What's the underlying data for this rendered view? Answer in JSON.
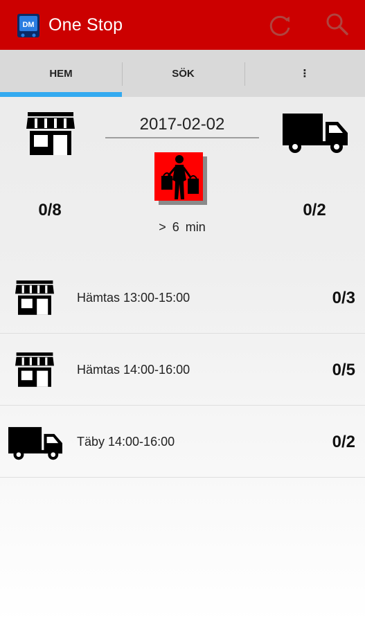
{
  "app": {
    "title": "One Stop",
    "logo_text": "DM",
    "accent_color": "#cc0000"
  },
  "toolbar": {
    "refresh_icon": "refresh-icon",
    "search_icon": "search-icon"
  },
  "tabs": [
    {
      "label": "HEM",
      "selected": true
    },
    {
      "label": "SÖK",
      "selected": false
    },
    {
      "label": "⋮",
      "selected": false
    }
  ],
  "summary": {
    "date": "2017-02-02",
    "store_count": "0/8",
    "delivery_count": "0/2",
    "wait_time": "> 6 min",
    "store_icon": "store-icon",
    "truck_icon": "truck-icon",
    "shopper_icon": "shopper-icon",
    "shopper_bg": "#ff0000"
  },
  "orders": [
    {
      "type": "store",
      "label": "Hämtas 13:00-15:00",
      "count": "0/3"
    },
    {
      "type": "store",
      "label": "Hämtas 14:00-16:00",
      "count": "0/5"
    },
    {
      "type": "delivery",
      "label": "Täby 14:00-16:00",
      "count": "0/2"
    }
  ]
}
